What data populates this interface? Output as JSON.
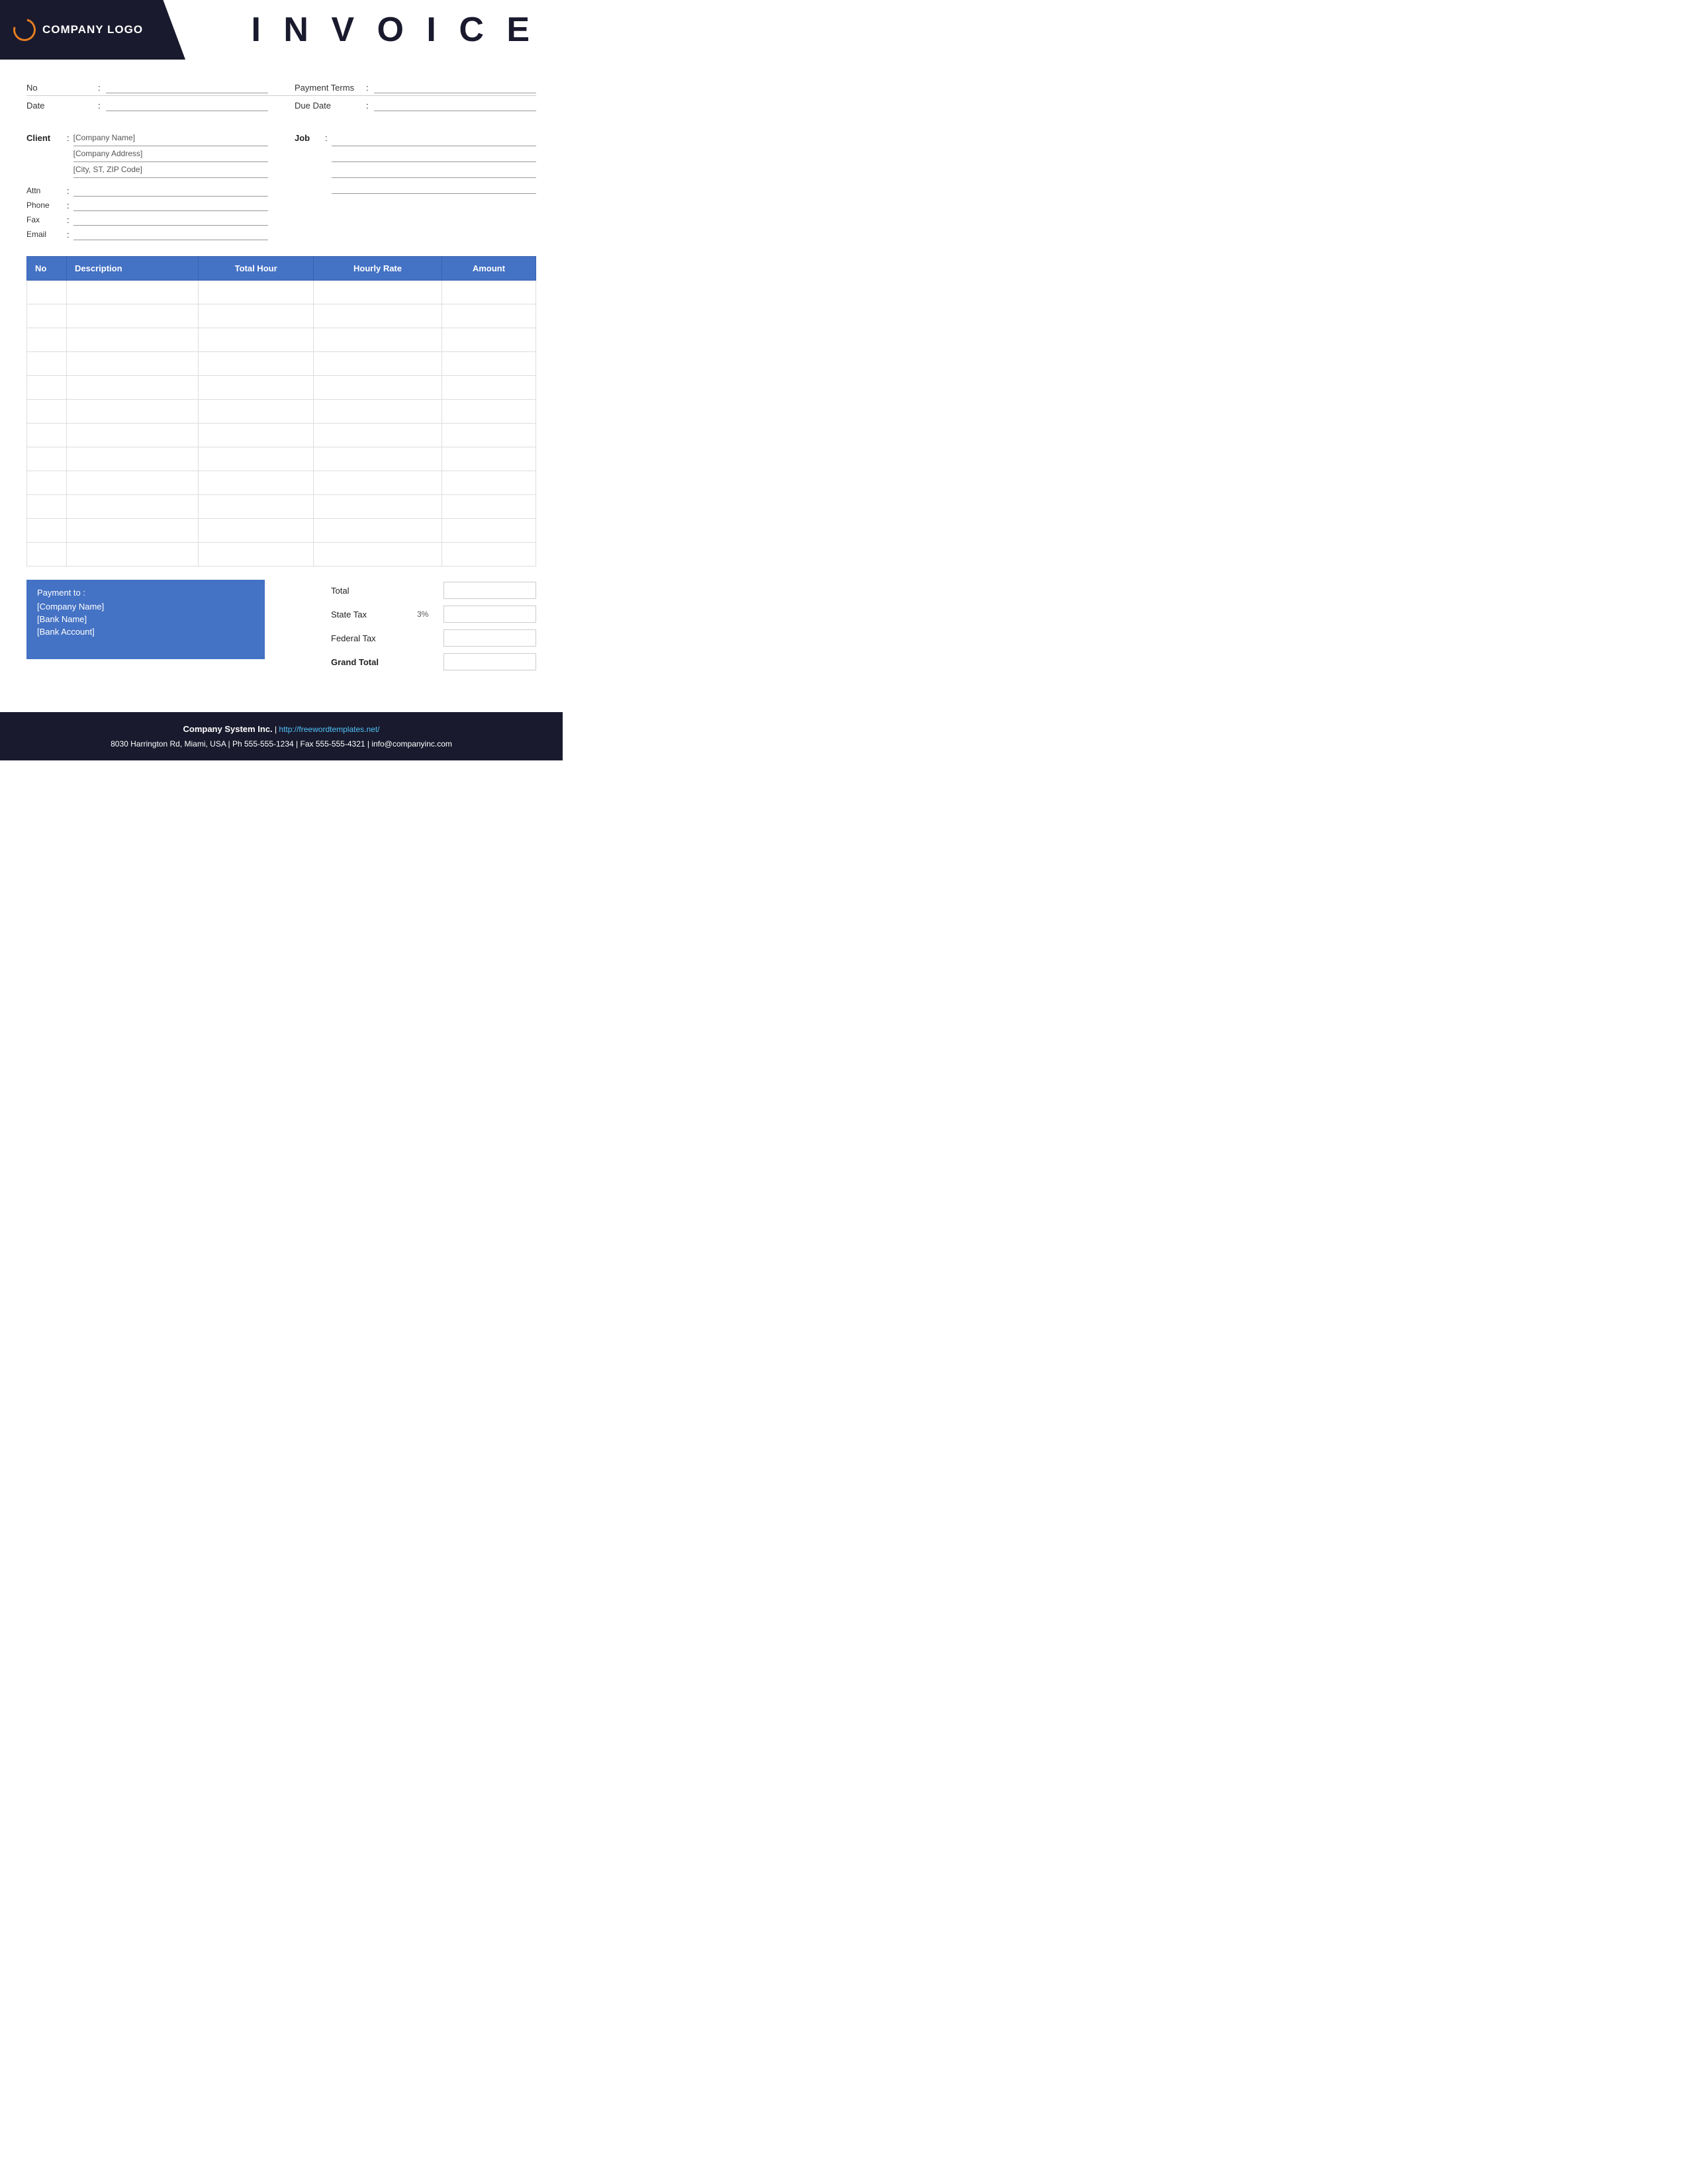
{
  "header": {
    "logo_text": "COMPANY LOGO",
    "invoice_title": "I N V O I C E"
  },
  "meta": {
    "no_label": "No",
    "no_colon": ":",
    "no_value": "",
    "date_label": "Date",
    "date_colon": ":",
    "date_value": "",
    "payment_terms_label": "Payment  Terms",
    "payment_terms_colon": ":",
    "payment_terms_value": "",
    "due_date_label": "Due Date",
    "due_date_colon": ":",
    "due_date_value": ""
  },
  "client": {
    "label": "Client",
    "colon": ":",
    "company_name": "[Company Name]",
    "company_address": "[Company Address]",
    "city_zip": "[City, ST, ZIP Code]",
    "attn_label": "Attn",
    "attn_colon": ":",
    "phone_label": "Phone",
    "phone_colon": ":",
    "fax_label": "Fax",
    "fax_colon": ":",
    "email_label": "Email",
    "email_colon": ":"
  },
  "job": {
    "label": "Job",
    "colon": ":",
    "lines": [
      "",
      "",
      "",
      ""
    ]
  },
  "table": {
    "headers": {
      "no": "No",
      "description": "Description",
      "total_hour": "Total Hour",
      "hourly_rate": "Hourly Rate",
      "amount": "Amount"
    },
    "rows": [
      {
        "no": "",
        "description": "",
        "total_hour": "",
        "hourly_rate": "",
        "amount": ""
      },
      {
        "no": "",
        "description": "",
        "total_hour": "",
        "hourly_rate": "",
        "amount": ""
      },
      {
        "no": "",
        "description": "",
        "total_hour": "",
        "hourly_rate": "",
        "amount": ""
      },
      {
        "no": "",
        "description": "",
        "total_hour": "",
        "hourly_rate": "",
        "amount": ""
      },
      {
        "no": "",
        "description": "",
        "total_hour": "",
        "hourly_rate": "",
        "amount": ""
      },
      {
        "no": "",
        "description": "",
        "total_hour": "",
        "hourly_rate": "",
        "amount": ""
      },
      {
        "no": "",
        "description": "",
        "total_hour": "",
        "hourly_rate": "",
        "amount": ""
      },
      {
        "no": "",
        "description": "",
        "total_hour": "",
        "hourly_rate": "",
        "amount": ""
      },
      {
        "no": "",
        "description": "",
        "total_hour": "",
        "hourly_rate": "",
        "amount": ""
      },
      {
        "no": "",
        "description": "",
        "total_hour": "",
        "hourly_rate": "",
        "amount": ""
      },
      {
        "no": "",
        "description": "",
        "total_hour": "",
        "hourly_rate": "",
        "amount": ""
      },
      {
        "no": "",
        "description": "",
        "total_hour": "",
        "hourly_rate": "",
        "amount": ""
      }
    ]
  },
  "payment": {
    "title": "Payment to :",
    "company": "[Company Name]",
    "bank": "[Bank Name]",
    "account": "[Bank Account]"
  },
  "totals": {
    "total_label": "Total",
    "state_tax_label": "State Tax",
    "state_tax_percent": "3%",
    "federal_tax_label": "Federal Tax",
    "grand_total_label": "Grand Total"
  },
  "footer": {
    "company": "Company System Inc.",
    "separator": "|",
    "website_label": "http://freewordtemplates.net/",
    "address": "8030 Harrington Rd, Miami, USA | Ph 555-555-1234 | Fax 555-555-4321 | info@companyinc.com"
  }
}
